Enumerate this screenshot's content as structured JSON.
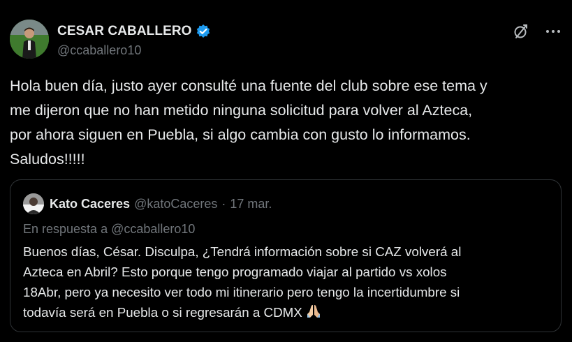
{
  "author": {
    "display_name": "CESAR CABALLERO",
    "handle": "@ccaballero10",
    "verified": true,
    "avatar_icon": "avatar-photo"
  },
  "actions": {
    "grok_icon": "slash-circle-icon",
    "more_icon": "more-icon"
  },
  "tweet_text": "Hola buen día, justo ayer consulté una fuente del club sobre ese tema y\nme dijeron que no han metido ninguna solicitud para volver al Azteca,\npor ahora siguen en Puebla, si algo cambia con gusto lo informamos.\nSaludos!!!!!",
  "quoted": {
    "display_name": "Kato Caceres",
    "handle": "@katoCaceres",
    "separator": "·",
    "date": "17 mar.",
    "reply_prefix": "En respuesta a",
    "reply_to": "@ccaballero10",
    "text": "Buenos días, César. Disculpa, ¿Tendrá información sobre si CAZ volverá al\nAzteca en Abril?  Esto porque tengo programado viajar al partido vs xolos\n18Abr, pero ya necesito ver todo mi itinerario pero tengo la incertidumbre si\ntodavía será en Puebla o si regresarán a CDMX",
    "emoji_icon": "folded-hands-icon"
  },
  "colors": {
    "background": "#000000",
    "text_primary": "#e7e9ea",
    "text_secondary": "#71767b",
    "border": "#2f3336",
    "verified_blue": "#1d9bf0"
  }
}
